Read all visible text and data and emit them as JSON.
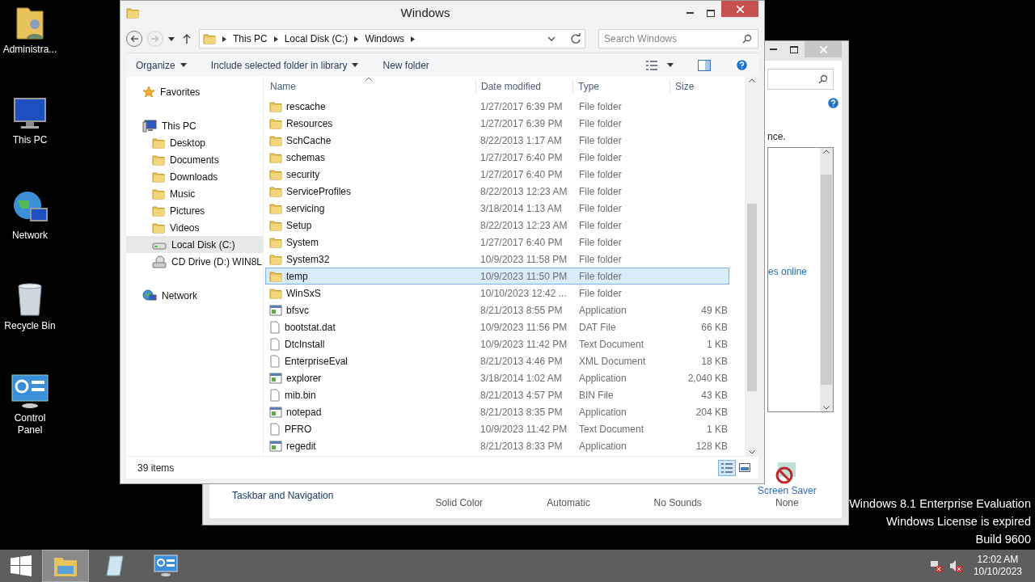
{
  "desktop_icons": [
    {
      "label": "Administra...",
      "kind": "user-folder"
    },
    {
      "label": "This PC",
      "kind": "computer"
    },
    {
      "label": "Network",
      "kind": "network"
    },
    {
      "label": "Recycle Bin",
      "kind": "recycle"
    },
    {
      "label": "Control Panel",
      "kind": "control-panel"
    }
  ],
  "background_window": {
    "partial_text": "nce.",
    "link": "es online",
    "left_link": "Taskbar and Navigation",
    "categories": [
      {
        "value": "Solid Color"
      },
      {
        "value": "Automatic"
      },
      {
        "value": "No Sounds"
      },
      {
        "label": "Screen Saver",
        "value": "None"
      }
    ]
  },
  "explorer": {
    "title": "Windows",
    "breadcrumbs": [
      "This PC",
      "Local Disk (C:)",
      "Windows"
    ],
    "search_placeholder": "Search Windows",
    "toolbar": [
      {
        "label": "Organize",
        "dropdown": true
      },
      {
        "label": "Include selected folder in library",
        "dropdown": true
      },
      {
        "label": "New folder",
        "dropdown": false
      }
    ],
    "nav": [
      {
        "label": "Favorites",
        "kind": "star",
        "selected": false
      },
      {
        "label": "This PC",
        "kind": "computer",
        "selected": false,
        "children": [
          {
            "label": "Desktop",
            "kind": "folder",
            "selected": false
          },
          {
            "label": "Documents",
            "kind": "folder",
            "selected": false
          },
          {
            "label": "Downloads",
            "kind": "folder",
            "selected": false
          },
          {
            "label": "Music",
            "kind": "folder",
            "selected": false
          },
          {
            "label": "Pictures",
            "kind": "folder",
            "selected": false
          },
          {
            "label": "Videos",
            "kind": "folder",
            "selected": false
          },
          {
            "label": "Local Disk (C:)",
            "kind": "drive",
            "selected": true
          },
          {
            "label": "CD Drive (D:) WIN8L",
            "kind": "cd",
            "selected": false
          }
        ]
      },
      {
        "label": "Network",
        "kind": "network",
        "selected": false
      }
    ],
    "columns": [
      "Name",
      "Date modified",
      "Type",
      "Size"
    ],
    "rows": [
      {
        "name": "rescache",
        "date": "1/27/2017 6:39 PM",
        "type": "File folder",
        "kind": "folder",
        "selected": false
      },
      {
        "name": "Resources",
        "date": "1/27/2017 6:39 PM",
        "type": "File folder",
        "kind": "folder",
        "selected": false
      },
      {
        "name": "SchCache",
        "date": "8/22/2013 1:17 AM",
        "type": "File folder",
        "kind": "folder",
        "selected": false
      },
      {
        "name": "schemas",
        "date": "1/27/2017 6:40 PM",
        "type": "File folder",
        "kind": "folder",
        "selected": false
      },
      {
        "name": "security",
        "date": "1/27/2017 6:40 PM",
        "type": "File folder",
        "kind": "folder",
        "selected": false
      },
      {
        "name": "ServiceProfiles",
        "date": "8/22/2013 12:23 AM",
        "type": "File folder",
        "kind": "folder",
        "selected": false
      },
      {
        "name": "servicing",
        "date": "3/18/2014 1:13 AM",
        "type": "File folder",
        "kind": "folder",
        "selected": false
      },
      {
        "name": "Setup",
        "date": "8/22/2013 12:23 AM",
        "type": "File folder",
        "kind": "folder",
        "selected": false
      },
      {
        "name": "System",
        "date": "1/27/2017 6:40 PM",
        "type": "File folder",
        "kind": "folder",
        "selected": false
      },
      {
        "name": "System32",
        "date": "10/9/2023 11:58 PM",
        "type": "File folder",
        "kind": "folder",
        "selected": false
      },
      {
        "name": "temp",
        "date": "10/9/2023 11:50 PM",
        "type": "File folder",
        "kind": "folder",
        "selected": true
      },
      {
        "name": "WinSxS",
        "date": "10/10/2023 12:42 ...",
        "type": "File folder",
        "kind": "folder",
        "selected": false
      },
      {
        "name": "bfsvc",
        "date": "8/21/2013 8:55 PM",
        "type": "Application",
        "size": "49 KB",
        "kind": "app",
        "selected": false
      },
      {
        "name": "bootstat.dat",
        "date": "10/9/2023 11:56 PM",
        "type": "DAT File",
        "size": "66 KB",
        "kind": "file",
        "selected": false
      },
      {
        "name": "DtcInstall",
        "date": "10/9/2023 11:42 PM",
        "type": "Text Document",
        "size": "1 KB",
        "kind": "file",
        "selected": false
      },
      {
        "name": "EnterpriseEval",
        "date": "8/21/2013 4:46 PM",
        "type": "XML Document",
        "size": "18 KB",
        "kind": "file",
        "selected": false
      },
      {
        "name": "explorer",
        "date": "3/18/2014 1:02 AM",
        "type": "Application",
        "size": "2,040 KB",
        "kind": "app",
        "selected": false
      },
      {
        "name": "mib.bin",
        "date": "8/21/2013 4:57 PM",
        "type": "BIN File",
        "size": "43 KB",
        "kind": "file",
        "selected": false
      },
      {
        "name": "notepad",
        "date": "8/21/2013 8:35 PM",
        "type": "Application",
        "size": "204 KB",
        "kind": "app",
        "selected": false
      },
      {
        "name": "PFRO",
        "date": "10/9/2023 11:42 PM",
        "type": "Text Document",
        "size": "1 KB",
        "kind": "file",
        "selected": false
      },
      {
        "name": "regedit",
        "date": "8/21/2013 8:33 PM",
        "type": "Application",
        "size": "128 KB",
        "kind": "app",
        "selected": false
      }
    ],
    "status": "39 items",
    "views": [
      {
        "kind": "details",
        "selected": true
      },
      {
        "kind": "thumbnails",
        "selected": false
      }
    ]
  },
  "license_notice": [
    "Windows 8.1 Enterprise Evaluation",
    "Windows License is expired",
    "Build 9600"
  ],
  "taskbar": {
    "apps": [
      {
        "kind": "explorer",
        "selected": true
      },
      {
        "kind": "notepad",
        "selected": false
      },
      {
        "kind": "control-panel",
        "selected": false
      }
    ],
    "time": "12:02 AM",
    "date": "10/10/2023"
  }
}
